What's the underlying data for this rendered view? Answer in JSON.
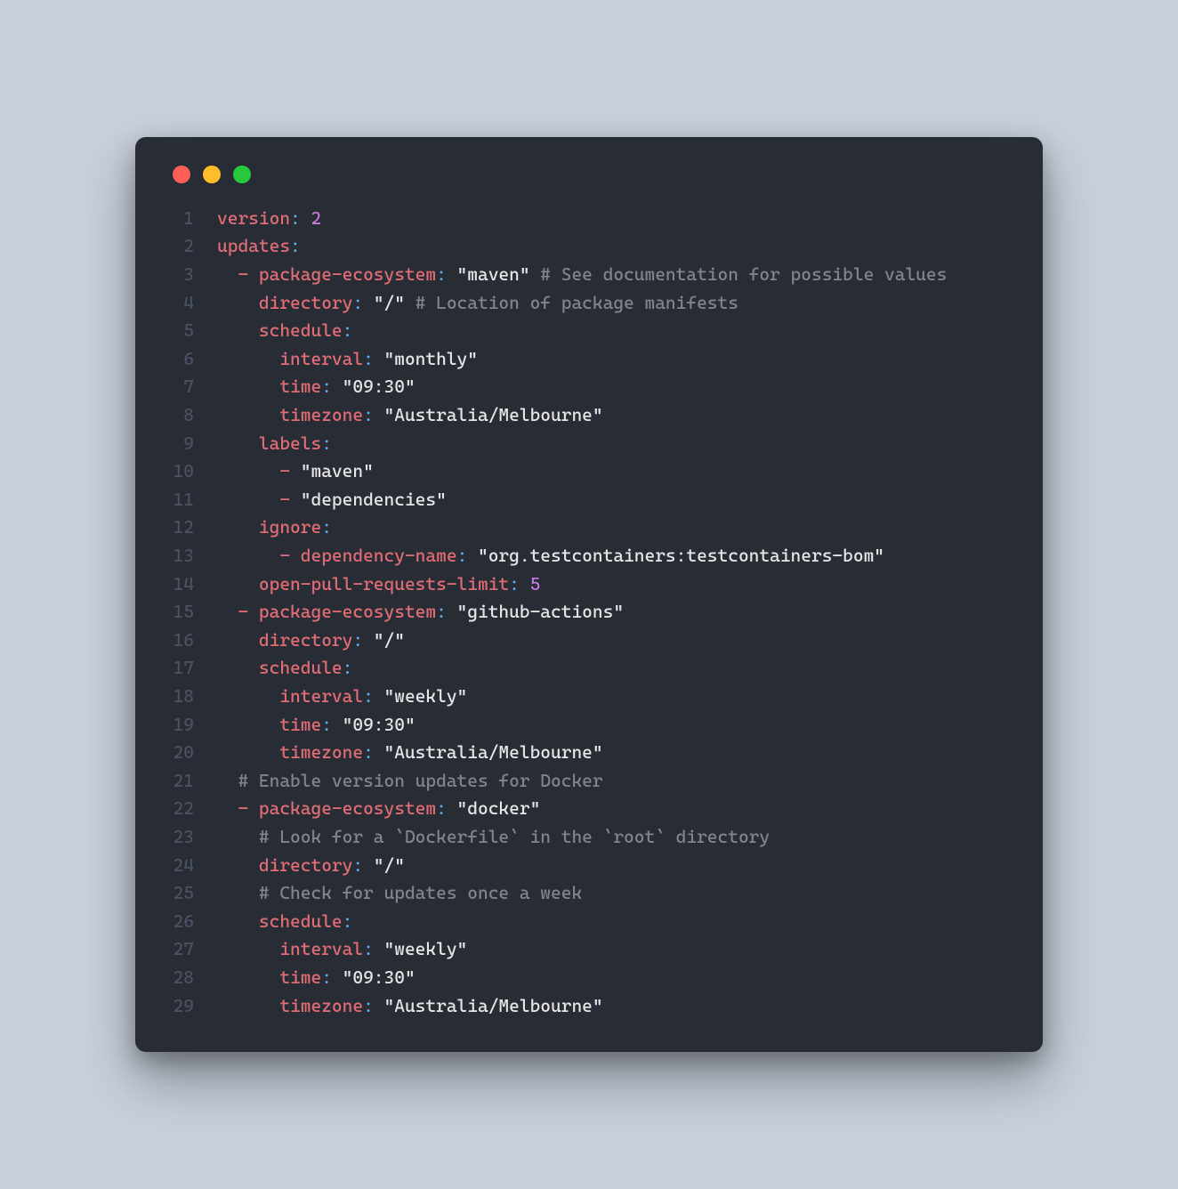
{
  "titlebar": {
    "close": "close",
    "min": "minimize",
    "max": "maximize"
  },
  "lines": {
    "l1n": "1",
    "l2n": "2",
    "l3n": "3",
    "l4n": "4",
    "l5n": "5",
    "l6n": "6",
    "l7n": "7",
    "l8n": "8",
    "l9n": "9",
    "l10n": "10",
    "l11n": "11",
    "l12n": "12",
    "l13n": "13",
    "l14n": "14",
    "l15n": "15",
    "l16n": "16",
    "l17n": "17",
    "l18n": "18",
    "l19n": "19",
    "l20n": "20",
    "l21n": "21",
    "l22n": "22",
    "l23n": "23",
    "l24n": "24",
    "l25n": "25",
    "l26n": "26",
    "l27n": "27",
    "l28n": "28",
    "l29n": "29"
  },
  "c": {
    "k_version": "version",
    "v_version": "2",
    "k_updates": "updates",
    "k_pkg": "package-ecosystem",
    "v_maven": "\"maven\"",
    "cm_see": " # See documentation for possible values",
    "k_dir": "directory",
    "v_slash": "\"/\"",
    "cm_loc": " # Location of package manifests",
    "k_sched": "schedule",
    "k_interval": "interval",
    "v_monthly": "\"monthly\"",
    "k_time": "time",
    "v_0930": "\"09:30\"",
    "k_tz": "timezone",
    "v_mel": "\"Australia/Melbourne\"",
    "k_labels": "labels",
    "v_lmaven": "\"maven\"",
    "v_ldeps": "\"dependencies\"",
    "k_ignore": "ignore",
    "k_depname": "dependency-name",
    "v_tcbom": "\"org.testcontainers:testcontainers-bom\"",
    "k_opr": "open-pull-requests-limit",
    "v_five": "5",
    "v_gha": "\"github-actions\"",
    "v_weekly": "\"weekly\"",
    "cm_docker": "# Enable version updates for Docker",
    "v_docker": "\"docker\"",
    "cm_look": "# Look for a `Dockerfile` in the `root` directory",
    "cm_check": "# Check for updates once a week"
  },
  "sep": {
    "colon": ":",
    "colsp": ": ",
    "dash": "- "
  },
  "ind": {
    "i0": "",
    "i2": "  ",
    "i4": "    ",
    "i6": "      ",
    "i8": "        "
  }
}
